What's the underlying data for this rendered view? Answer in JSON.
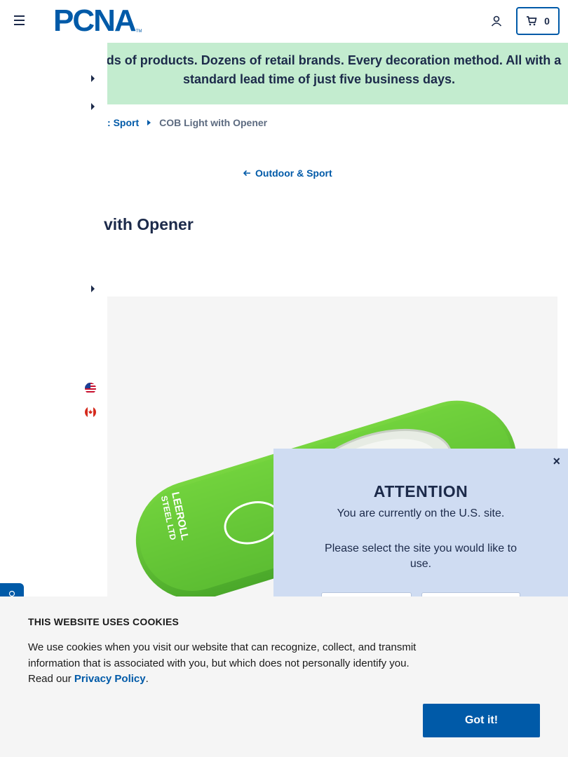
{
  "header": {
    "logo_text": "PCNA",
    "logo_tm": "TM",
    "cart_count": "0"
  },
  "banner": {
    "text": "usands of products. Dozens of retail brands. Every decoration method. All with a standard lead time of just five business days."
  },
  "breadcrumb": {
    "parent": "Sport",
    "parent_prefix": ":",
    "current": "COB Light with Opener"
  },
  "back_link": {
    "label": "Outdoor & Sport"
  },
  "product": {
    "title_visible": "vith Opener",
    "imprint_line1": "LEEROLL",
    "imprint_line2": "STEEL LTD"
  },
  "modal": {
    "close_label": "×",
    "title": "ATTENTION",
    "line1": "You are currently on the U.S. site.",
    "line2": "Please select the site you would like to use."
  },
  "cookie": {
    "title": "THIS WEBSITE USES COOKIES",
    "text": "We use cookies when you visit our website that can recognize, collect, and transmit information that is associated with you, but which does not personally identify you. Read our ",
    "link": "Privacy Policy",
    "text_end": ".",
    "button": "Got it!"
  },
  "colors": {
    "brand": "#005aa8",
    "banner_bg": "#c3eccf",
    "modal_bg": "#cfdcf2",
    "product_green": "#5ec82f"
  }
}
